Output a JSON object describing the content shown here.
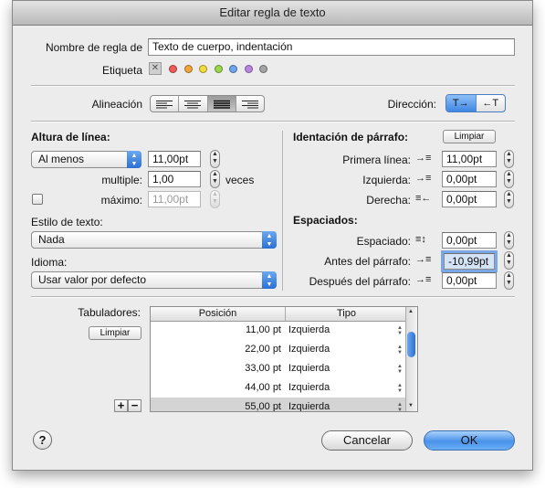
{
  "window": {
    "title": "Editar regla de texto"
  },
  "rule_name": {
    "label": "Nombre de regla de",
    "value": "Texto de cuerpo, indentación"
  },
  "tag": {
    "label": "Etiqueta",
    "none_symbol": "✕",
    "colors": [
      "#ef5b5b",
      "#f3a53b",
      "#f2dc3c",
      "#9ad74a",
      "#6ba4ef",
      "#b985e0",
      "#a4a4a4"
    ]
  },
  "alignment": {
    "label": "Alineación"
  },
  "direction": {
    "label": "Dirección:",
    "ltr": "T→",
    "rtl": "←T"
  },
  "line_height": {
    "title": "Altura de línea:",
    "mode": "Al menos",
    "value": "11,00pt",
    "multiple_label": "multiple:",
    "multiple_value": "1,00",
    "multiple_unit": "veces",
    "max_label": "máximo:",
    "max_value": "11,00pt"
  },
  "text_style": {
    "label": "Estilo de texto:",
    "value": "Nada"
  },
  "language": {
    "label": "Idioma:",
    "value": "Usar valor por defecto"
  },
  "indent": {
    "title": "Identación de párrafo:",
    "clear_label": "Limpiar",
    "first_line_label": "Primera línea:",
    "first_line_value": "11,00pt",
    "left_label": "Izquierda:",
    "left_value": "0,00pt",
    "right_label": "Derecha:",
    "right_value": "0,00pt"
  },
  "spacing": {
    "title": "Espaciados:",
    "spacing_label": "Espaciado:",
    "spacing_value": "0,00pt",
    "before_label": "Antes del párrafo:",
    "before_value": "-10,99pt",
    "after_label": "Después del párrafo:",
    "after_value": "0,00pt"
  },
  "tabs": {
    "label": "Tabuladores:",
    "clear_label": "Limpiar",
    "col_position": "Posición",
    "col_type": "Tipo",
    "rows": [
      {
        "position": "11,00 pt",
        "type": "Izquierda"
      },
      {
        "position": "22,00 pt",
        "type": "Izquierda"
      },
      {
        "position": "33,00 pt",
        "type": "Izquierda"
      },
      {
        "position": "44,00 pt",
        "type": "Izquierda"
      },
      {
        "position": "55,00 pt",
        "type": "Izquierda"
      }
    ],
    "add": "+",
    "remove": "−"
  },
  "buttons": {
    "help": "?",
    "cancel": "Cancelar",
    "ok": "OK"
  }
}
